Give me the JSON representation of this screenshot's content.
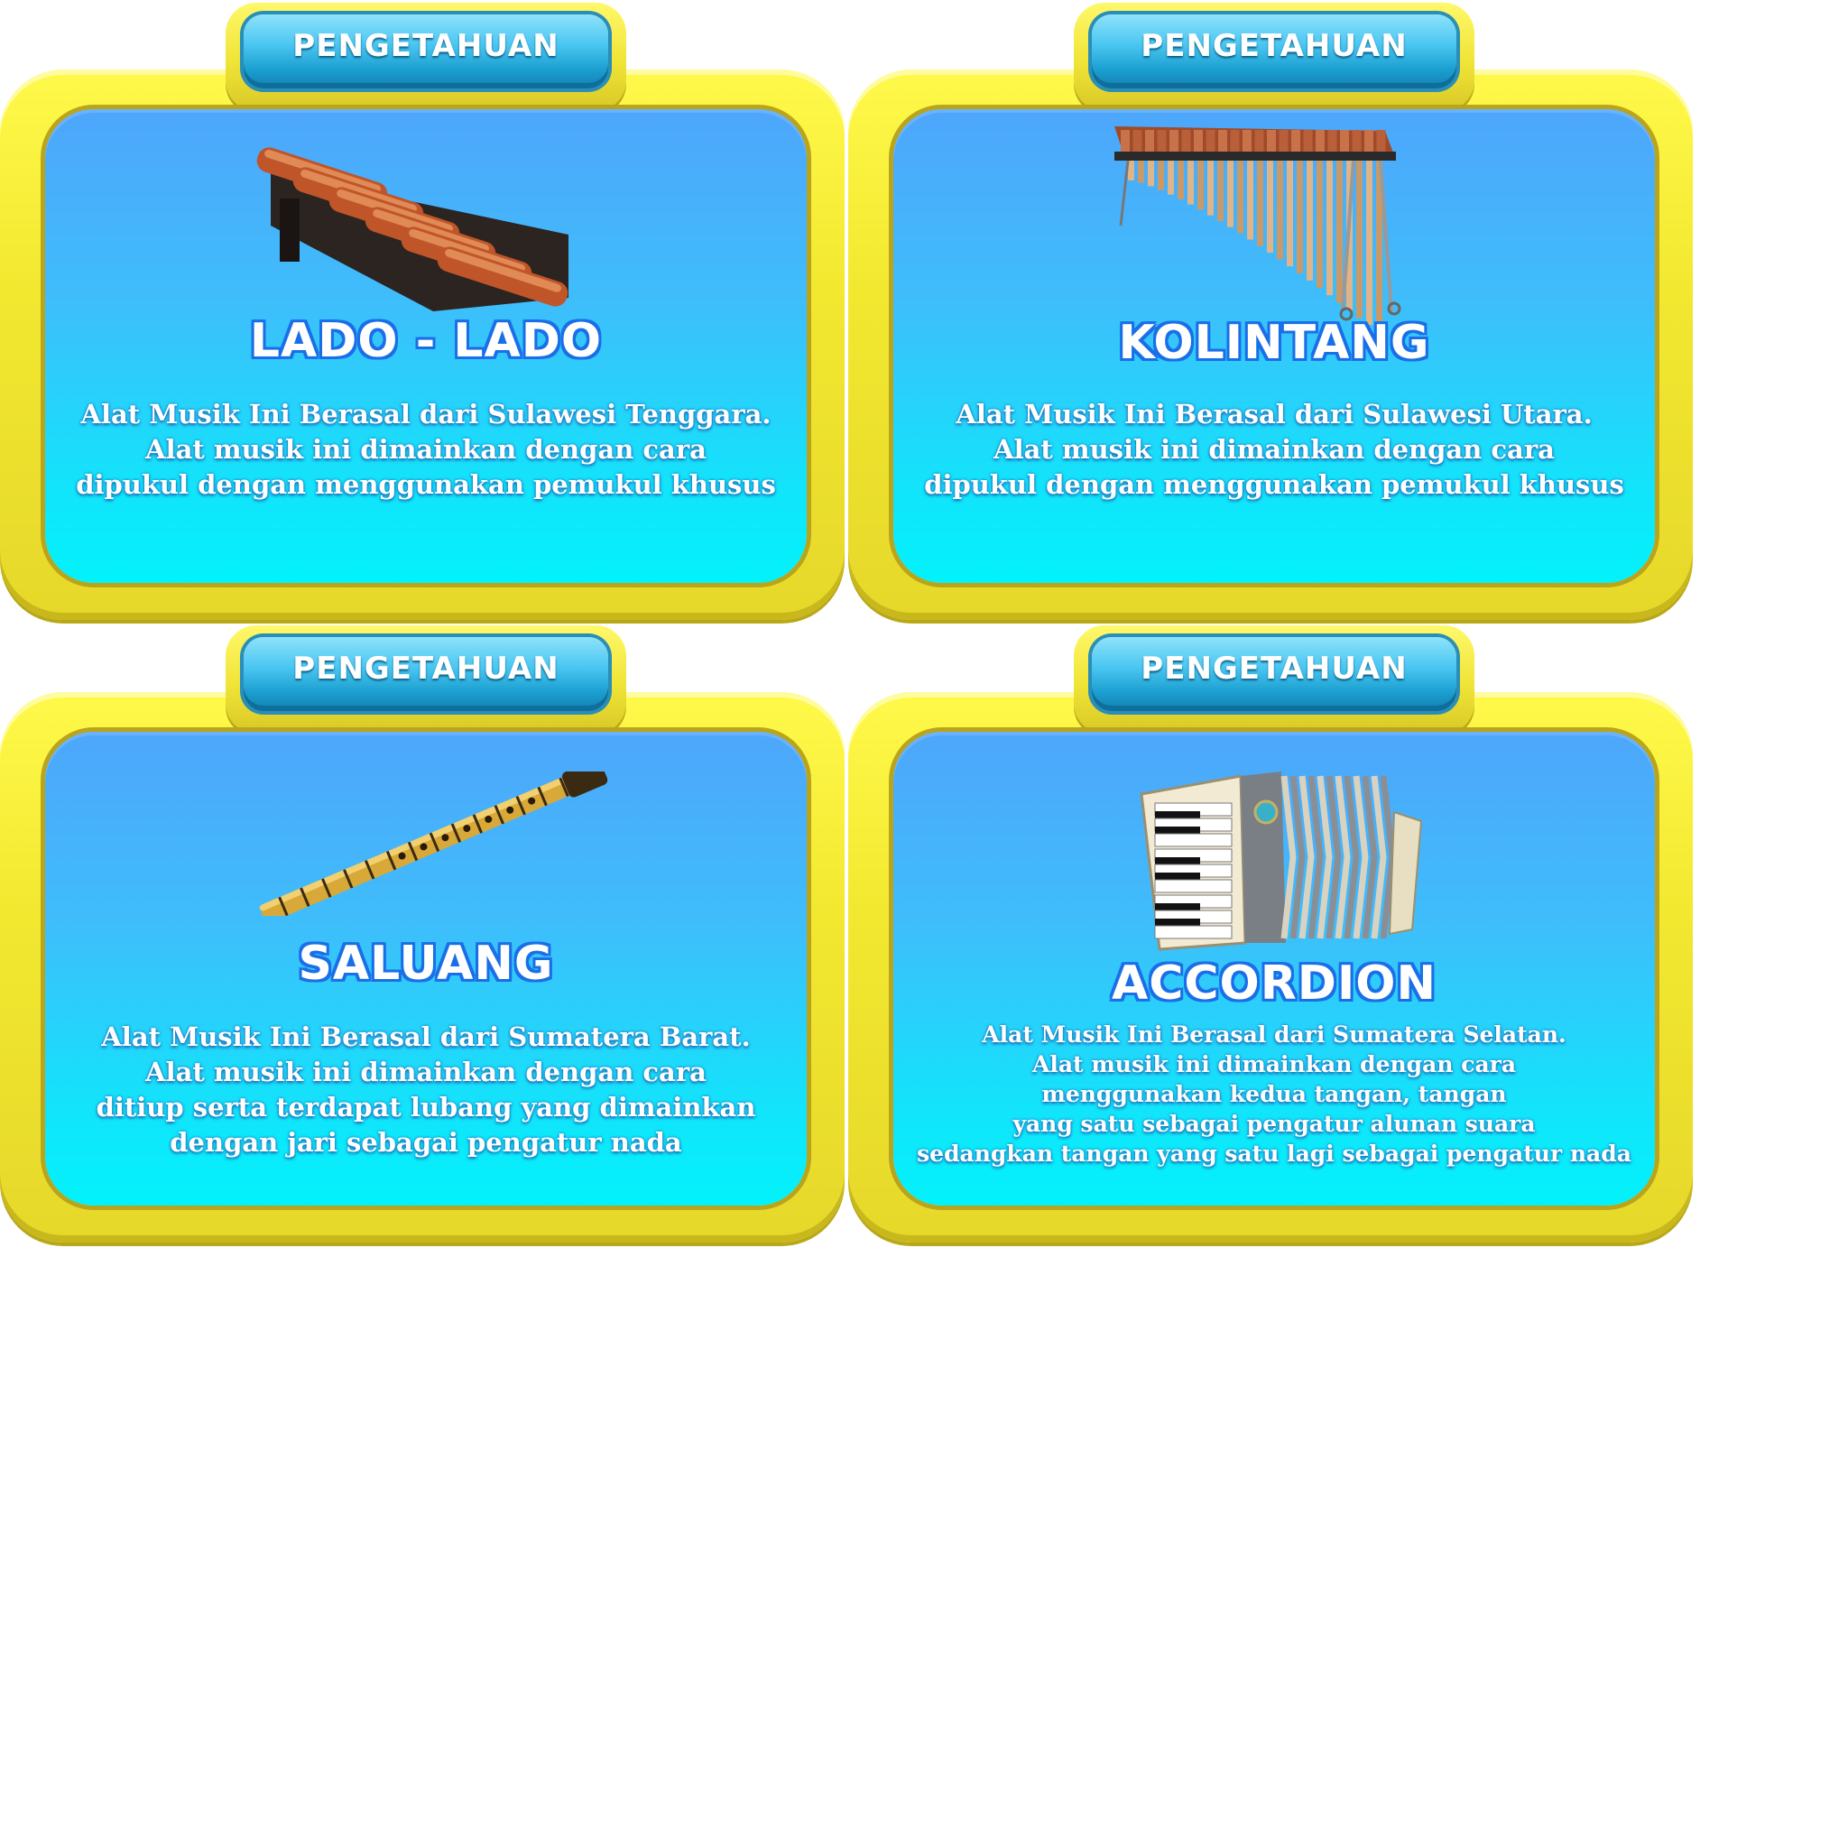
{
  "cards": [
    {
      "tab_label": "PENGETAHUAN",
      "title": "LADO - LADO",
      "lines": [
        "Alat Musik Ini Berasal dari Sulawesi Tenggara.",
        "Alat musik ini dimainkan dengan cara",
        "dipukul dengan menggunakan pemukul khusus"
      ]
    },
    {
      "tab_label": "PENGETAHUAN",
      "title": "KOLINTANG",
      "lines": [
        "Alat Musik Ini Berasal dari Sulawesi Utara.",
        "Alat musik ini dimainkan dengan cara",
        "dipukul dengan menggunakan pemukul khusus"
      ]
    },
    {
      "tab_label": "PENGETAHUAN",
      "title": "SALUANG",
      "lines": [
        "Alat Musik Ini Berasal dari Sumatera Barat.",
        "Alat musik ini dimainkan dengan cara",
        "ditiup serta terdapat lubang yang dimainkan",
        "dengan jari sebagai pengatur nada"
      ]
    },
    {
      "tab_label": "PENGETAHUAN",
      "title": "ACCORDION",
      "lines": [
        "Alat Musik Ini Berasal dari Sumatera Selatan.",
        "Alat musik ini dimainkan dengan cara",
        "menggunakan kedua tangan, tangan",
        "yang satu sebagai pengatur alunan suara",
        "sedangkan tangan yang satu lagi sebagai pengatur nada"
      ]
    }
  ]
}
